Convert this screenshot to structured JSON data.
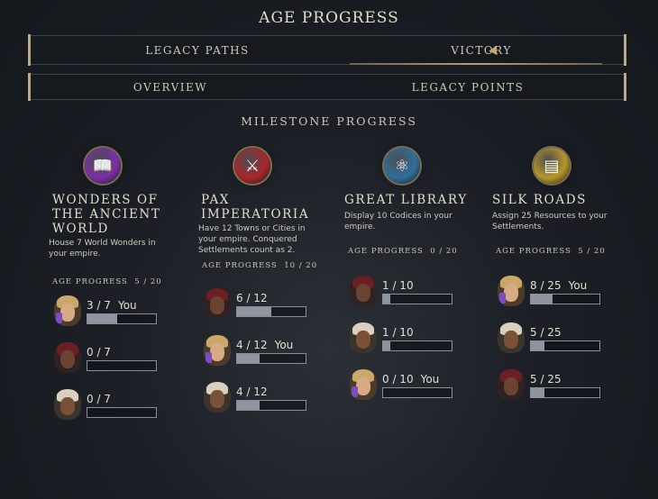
{
  "screen": {
    "title": "AGE PROGRESS"
  },
  "tabs": [
    {
      "label": "LEGACY PATHS"
    },
    {
      "label": "VICTORY",
      "selected": true
    }
  ],
  "subtabs": [
    {
      "label": "OVERVIEW"
    },
    {
      "label": "LEGACY POINTS"
    }
  ],
  "section_title": "MILESTONE PROGRESS",
  "columns": [
    {
      "title": "WONDERS OF THE ANCIENT WORLD",
      "title_lines": [
        "WONDERS OF",
        "THE ANCIENT",
        "WORLD"
      ],
      "description": "House 7 World Wonders in your empire.",
      "age_progress": "AGE PROGRESS  5 / 20",
      "emblem_icon": "open-book-icon",
      "emblem_color": "#7a2fa6",
      "players": [
        {
          "score": "3 / 7",
          "you_label": "You",
          "progress": 0.43,
          "avatar": "bearded-man"
        },
        {
          "score": "0 / 7",
          "you_label": "",
          "progress": 0.0,
          "avatar": "red-turban"
        },
        {
          "score": "0 / 7",
          "you_label": "",
          "progress": 0.0,
          "avatar": "white-headwrap"
        }
      ]
    },
    {
      "title": "PAX IMPERATORIA",
      "title_lines": [
        "PAX",
        "IMPERATORIA"
      ],
      "description": "Have 12 Towns or Cities in your empire. Conquered Settlements count as 2.",
      "age_progress": "AGE PROGRESS  10 / 20",
      "emblem_icon": "shield-sword-icon",
      "emblem_color": "#a8262b",
      "players": [
        {
          "score": "6 / 12",
          "you_label": "",
          "progress": 0.5,
          "avatar": "red-turban"
        },
        {
          "score": "4 / 12",
          "you_label": "You",
          "progress": 0.33,
          "avatar": "bearded-man"
        },
        {
          "score": "4 / 12",
          "you_label": "",
          "progress": 0.33,
          "avatar": "white-headwrap"
        }
      ]
    },
    {
      "title": "GREAT LIBRARY",
      "title_lines": [
        "GREAT LIBRARY"
      ],
      "description": "Display 10 Codices in your empire.",
      "age_progress": "AGE PROGRESS  0 / 20",
      "emblem_icon": "atom-icon",
      "emblem_color": "#2f6f9a",
      "players": [
        {
          "score": "1 / 10",
          "you_label": "",
          "progress": 0.1,
          "avatar": "red-turban"
        },
        {
          "score": "1 / 10",
          "you_label": "",
          "progress": 0.1,
          "avatar": "white-headwrap"
        },
        {
          "score": "0 / 10",
          "you_label": "You",
          "progress": 0.0,
          "avatar": "bearded-man"
        }
      ]
    },
    {
      "title": "SILK ROADS",
      "title_lines": [
        "SILK ROADS"
      ],
      "description": "Assign 25 Resources to your Settlements.",
      "age_progress": "AGE PROGRESS  5 / 20",
      "emblem_icon": "coin-stack-icon",
      "emblem_color": "#b8962a",
      "players": [
        {
          "score": "8 / 25",
          "you_label": "You",
          "progress": 0.32,
          "avatar": "bearded-man"
        },
        {
          "score": "5 / 25",
          "you_label": "",
          "progress": 0.2,
          "avatar": "white-headwrap"
        },
        {
          "score": "5 / 25",
          "you_label": "",
          "progress": 0.2,
          "avatar": "red-turban"
        }
      ]
    }
  ],
  "colors": {
    "avatar_you": "#7b4cc2",
    "bar_fill": "#8e95a1",
    "gold_frame": "#b9a98a"
  }
}
